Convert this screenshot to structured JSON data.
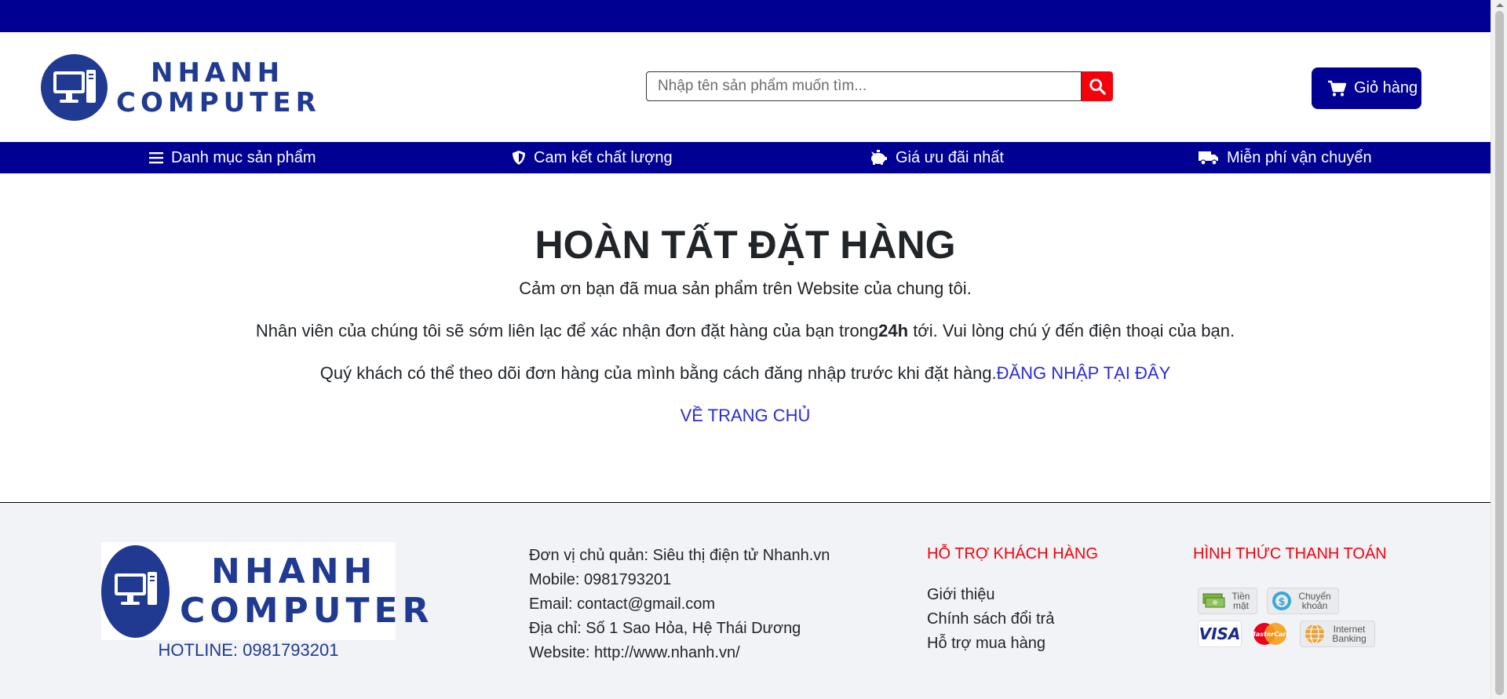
{
  "brand": {
    "name_line1": "NHANH",
    "name_line2": "COMPUTER",
    "color": "#203a92"
  },
  "colors": {
    "topbar": "#000093",
    "accent_red": "#f3020c",
    "link": "#2b2bd8"
  },
  "search": {
    "placeholder": "Nhập tên sản phẩm muốn tìm...",
    "value": "",
    "icon": "search-icon"
  },
  "cart": {
    "label": "Giỏ hàng",
    "icon": "cart-icon"
  },
  "nav": {
    "items": [
      {
        "label": "Danh mục sản phẩm",
        "icon": "menu-icon"
      },
      {
        "label": "Cam kết chất lượng",
        "icon": "shield-icon"
      },
      {
        "label": "Giá ưu đãi nhất",
        "icon": "piggy-bank-icon"
      },
      {
        "label": "Miễn phí vận chuyển",
        "icon": "truck-icon"
      }
    ]
  },
  "main": {
    "title": "HOÀN TẤT ĐẶT HÀNG",
    "thanks": "Cảm ơn bạn đã mua sản phẩm trên Website của chung tôi.",
    "contact_before": "Nhân viên của chúng tôi sẽ sớm liên lạc để xác nhận đơn đặt hàng của bạn trong",
    "contact_bold": "24h",
    "contact_after": " tới. Vui lòng chú ý đến điện thoại của bạn.",
    "track_text": "Quý khách có thể theo dõi đơn hàng của mình bằng cách đăng nhập trước khi đặt hàng.",
    "login_link": "ĐĂNG NHẬP TẠI ĐÂY",
    "home_link": "VỀ TRANG CHỦ"
  },
  "footer": {
    "hotline": "HOTLINE: 0981793201",
    "info": [
      "Đơn vị chủ quản: Siêu thị điện tử Nhanh.vn",
      "Mobile: 0981793201",
      "Email: contact@gmail.com",
      "Địa chỉ: Số 1 Sao Hỏa, Hệ Thái Dương",
      "Website: http://www.nhanh.vn/"
    ],
    "support_heading": "HỖ TRỢ KHÁCH HÀNG",
    "support_links": [
      "Giới thiệu",
      "Chính sách đổi trả",
      "Hỗ trợ mua hàng"
    ],
    "payment_heading": "HÌNH THỨC THANH TOÁN",
    "payment": {
      "cash": "Tiền mặt",
      "transfer": "Chuyển khoản",
      "visa": "VISA",
      "mastercard": "MasterCard",
      "internet_banking": "Internet Banking"
    }
  }
}
